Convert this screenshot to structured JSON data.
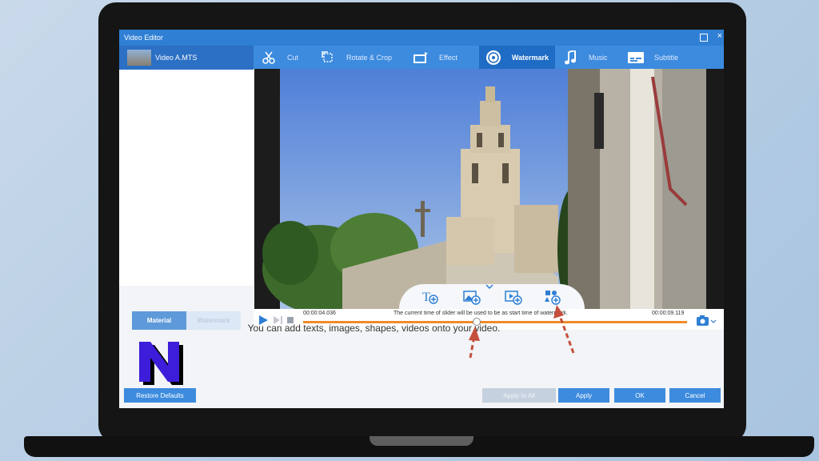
{
  "window": {
    "title": "Video Editor"
  },
  "sidebar": {
    "file_name": "Video A.MTS",
    "tabs": [
      {
        "label": "Material"
      },
      {
        "label": "Watermark"
      }
    ]
  },
  "toolbar": {
    "tools": [
      {
        "label": "Cut",
        "icon": "scissors-icon"
      },
      {
        "label": "Rotate & Crop",
        "icon": "crop-icon"
      },
      {
        "label": "Effect",
        "icon": "effect-icon"
      },
      {
        "label": "Watermark",
        "icon": "watermark-icon",
        "active": true
      },
      {
        "label": "Music",
        "icon": "music-note-icon"
      },
      {
        "label": "Subtitle",
        "icon": "subtitle-icon"
      }
    ]
  },
  "player": {
    "current_time": "00:00:04.036",
    "total_time": "00:00:09.119",
    "hint": "The current time of slider will be used to be as start time of watermark.",
    "progress": 0.44
  },
  "add_bar": {
    "items": [
      "add-text-icon",
      "add-image-icon",
      "add-video-icon",
      "add-shape-icon"
    ]
  },
  "content": {
    "message": "You can add texts, images, shapes, videos onto your video."
  },
  "footer": {
    "restore_label": "Restore Defaults",
    "apply_all_label": "Apply to All",
    "apply_label": "Apply",
    "ok_label": "OK",
    "cancel_label": "Cancel"
  },
  "colors": {
    "accent": "#3c8bde",
    "slider": "#f18a2b",
    "annotation_arrow": "#c44f3c",
    "logo": "#3d1dd9"
  }
}
